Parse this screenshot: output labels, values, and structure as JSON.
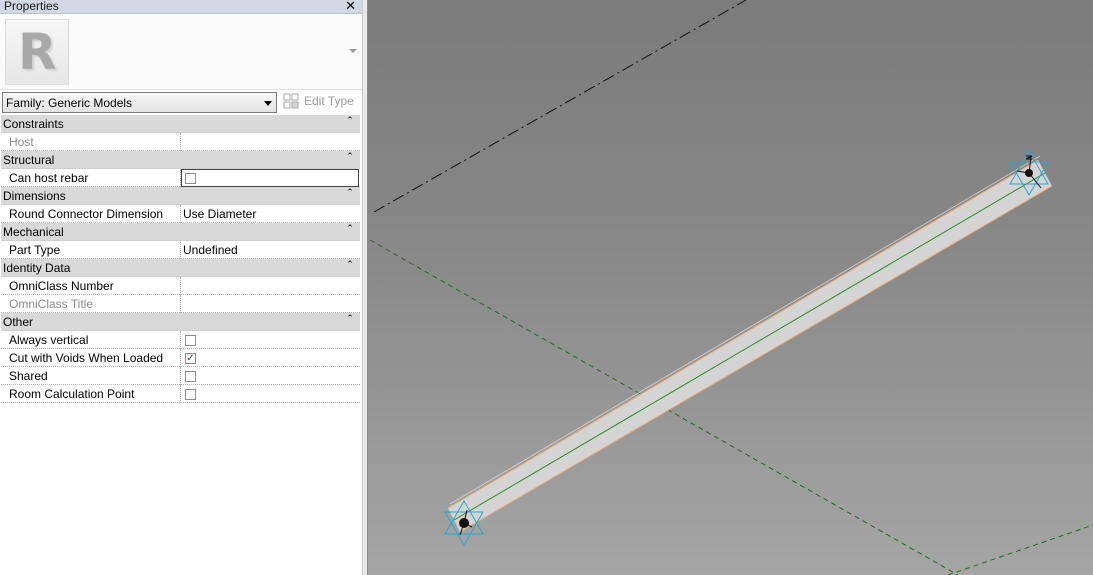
{
  "properties_panel": {
    "title": "Properties",
    "close_glyph": "✕",
    "type_thumbnail_letter": "R",
    "family_select": {
      "value": "Family: Generic Models"
    },
    "edit_type_label": "Edit Type",
    "collapse_glyph": "⌃",
    "check_glyph": "✓",
    "groups": [
      {
        "name": "Constraints",
        "rows": [
          {
            "label": "Host",
            "value": "",
            "kind": "text",
            "dim": true
          }
        ]
      },
      {
        "name": "Structural",
        "rows": [
          {
            "label": "Can host rebar",
            "kind": "checkbox",
            "checked": false,
            "editing": true
          }
        ]
      },
      {
        "name": "Dimensions",
        "rows": [
          {
            "label": "Round Connector Dimension",
            "value": "Use Diameter",
            "kind": "text"
          }
        ]
      },
      {
        "name": "Mechanical",
        "rows": [
          {
            "label": "Part Type",
            "value": "Undefined",
            "kind": "text"
          }
        ]
      },
      {
        "name": "Identity Data",
        "rows": [
          {
            "label": "OmniClass Number",
            "value": "",
            "kind": "text"
          },
          {
            "label": "OmniClass Title",
            "value": "",
            "kind": "text",
            "dim": true
          }
        ]
      },
      {
        "name": "Other",
        "rows": [
          {
            "label": "Always vertical",
            "kind": "checkbox",
            "checked": false
          },
          {
            "label": "Cut with Voids When Loaded",
            "kind": "checkbox",
            "checked": true
          },
          {
            "label": "Shared",
            "kind": "checkbox",
            "checked": false
          },
          {
            "label": "Room Calculation Point",
            "kind": "checkbox",
            "checked": false
          }
        ]
      }
    ]
  },
  "viewport": {
    "background": "#8a8a8a",
    "reference_line_color": "#111111",
    "ref_plane_color": "#1f6e1f",
    "pipe_fill": "#d4d4d4",
    "pipe_edge_color": "#e6a978",
    "pipe_centerline_color": "#2a8a2a",
    "connector_color": "#2aa6d6"
  }
}
